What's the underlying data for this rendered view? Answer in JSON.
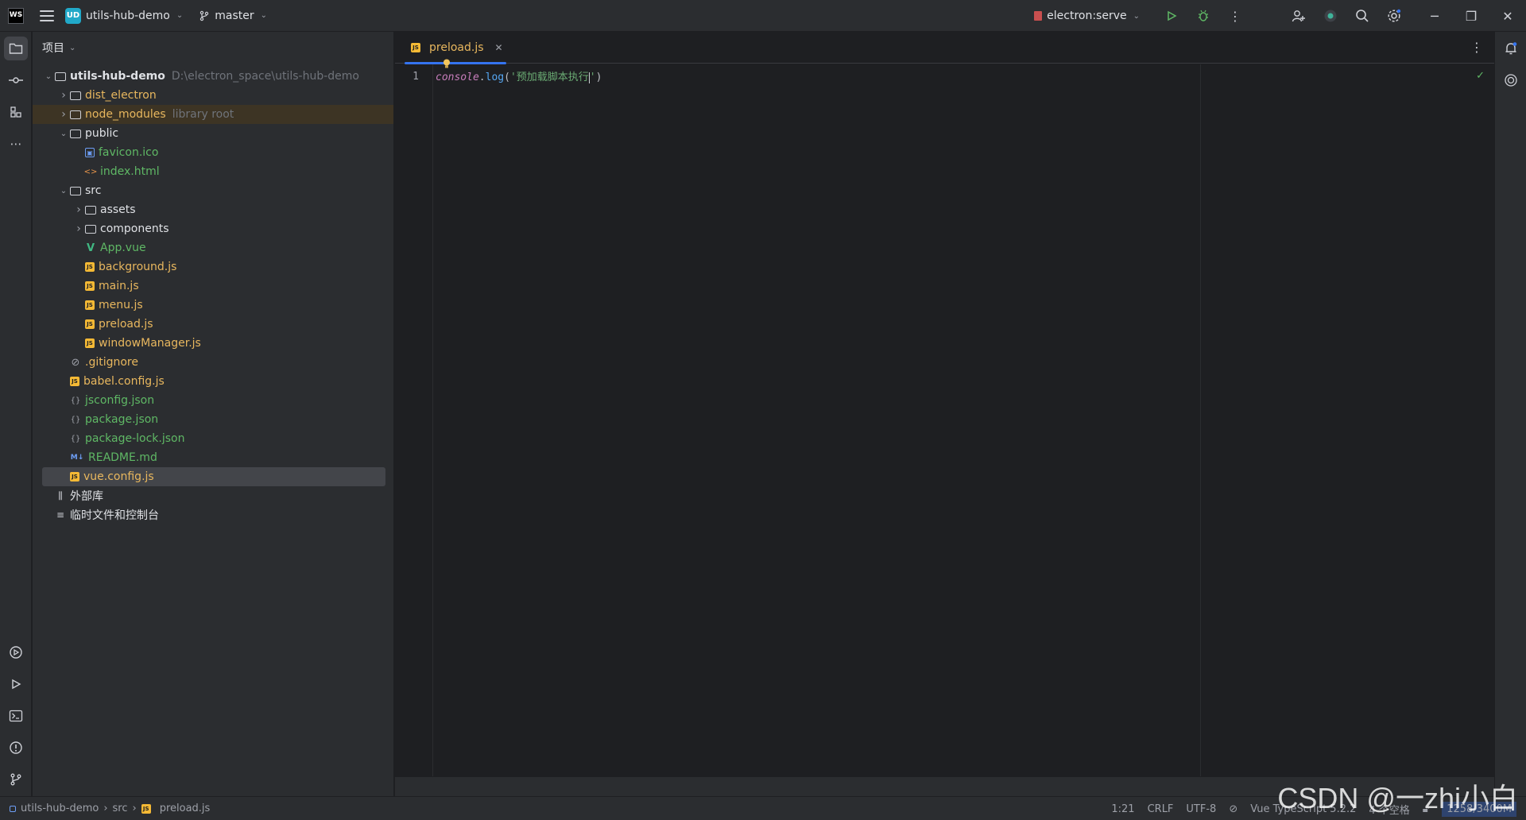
{
  "titlebar": {
    "logo_text": "WS",
    "project_badge": "UD",
    "project_name": "utils-hub-demo",
    "branch": "master",
    "run_config": "electron:serve",
    "icons": [
      "menu-icon",
      "branch-icon",
      "run-icon",
      "debug-icon",
      "more-icon",
      "add-user-icon",
      "ai-status-icon",
      "search-icon",
      "settings-icon",
      "minimize-icon",
      "restore-icon",
      "close-icon"
    ]
  },
  "left_strip": {
    "icons": [
      "folder-icon",
      "commit-icon",
      "structure-icon",
      "more-tools-icon",
      "services-icon",
      "run-tool-icon",
      "terminal-icon",
      "problems-icon",
      "git-icon"
    ]
  },
  "project_panel": {
    "title": "项目",
    "tree": [
      {
        "label": "utils-hub-demo",
        "note": "D:\\electron_space\\utils-hub-demo",
        "depth": 0,
        "type": "folder",
        "expanded": true,
        "color": "white"
      },
      {
        "label": "dist_electron",
        "depth": 1,
        "type": "folder",
        "expanded": false,
        "color": "orange"
      },
      {
        "label": "node_modules",
        "note": "library root",
        "depth": 1,
        "type": "folder",
        "expanded": false,
        "color": "orange",
        "highlight": true
      },
      {
        "label": "public",
        "depth": 1,
        "type": "folder",
        "expanded": true,
        "color": "default"
      },
      {
        "label": "favicon.ico",
        "depth": 2,
        "type": "image",
        "color": "green"
      },
      {
        "label": "index.html",
        "depth": 2,
        "type": "html",
        "color": "green"
      },
      {
        "label": "src",
        "depth": 1,
        "type": "folder",
        "expanded": true,
        "color": "default"
      },
      {
        "label": "assets",
        "depth": 2,
        "type": "folder",
        "expanded": false,
        "color": "default"
      },
      {
        "label": "components",
        "depth": 2,
        "type": "folder",
        "expanded": false,
        "color": "default"
      },
      {
        "label": "App.vue",
        "depth": 2,
        "type": "vue",
        "color": "green"
      },
      {
        "label": "background.js",
        "depth": 2,
        "type": "js",
        "color": "orange"
      },
      {
        "label": "main.js",
        "depth": 2,
        "type": "js",
        "color": "orange"
      },
      {
        "label": "menu.js",
        "depth": 2,
        "type": "js",
        "color": "orange"
      },
      {
        "label": "preload.js",
        "depth": 2,
        "type": "js",
        "color": "orange"
      },
      {
        "label": "windowManager.js",
        "depth": 2,
        "type": "js",
        "color": "orange"
      },
      {
        "label": ".gitignore",
        "depth": 1,
        "type": "ignore",
        "color": "orange"
      },
      {
        "label": "babel.config.js",
        "depth": 1,
        "type": "js",
        "color": "orange"
      },
      {
        "label": "jsconfig.json",
        "depth": 1,
        "type": "json",
        "color": "green"
      },
      {
        "label": "package.json",
        "depth": 1,
        "type": "json",
        "color": "green"
      },
      {
        "label": "package-lock.json",
        "depth": 1,
        "type": "json",
        "color": "green"
      },
      {
        "label": "README.md",
        "depth": 1,
        "type": "md",
        "color": "green"
      },
      {
        "label": "vue.config.js",
        "depth": 1,
        "type": "js",
        "color": "orange",
        "selected": true
      },
      {
        "label": "外部库",
        "depth": 0,
        "type": "library",
        "color": "default"
      },
      {
        "label": "临时文件和控制台",
        "depth": 0,
        "type": "scratch",
        "color": "default"
      }
    ]
  },
  "editor": {
    "tab_label": "preload.js",
    "line_numbers": [
      "1"
    ],
    "code": {
      "obj": "console",
      "dot": ".",
      "fn": "log",
      "open": "(",
      "str": "'预加载脚本执行",
      "str_end": "'",
      "close": ")"
    }
  },
  "statusbar": {
    "breadcrumbs": [
      "utils-hub-demo",
      "src",
      "preload.js"
    ],
    "position": "1:21",
    "line_ending": "CRLF",
    "encoding": "UTF-8",
    "language": "Vue TypeScript 5.2.2",
    "indent": "4 个空格",
    "memory": "1258/3400M"
  },
  "watermark": "CSDN @一zhi小白",
  "colors": {
    "accent": "#3574f0",
    "orange_file": "#e8b75e",
    "green_file": "#5fb865",
    "highlight_row": "#3d3424"
  }
}
